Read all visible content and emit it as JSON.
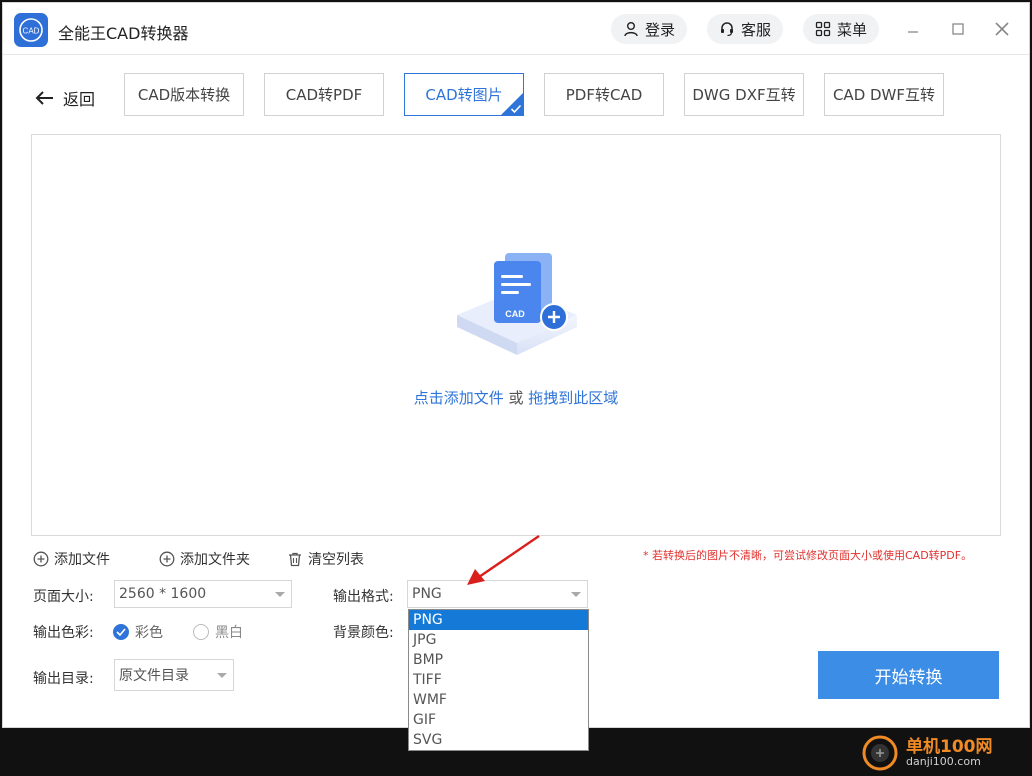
{
  "app": {
    "title": "全能王CAD转换器",
    "logo_text": "CAD"
  },
  "header": {
    "login_label": "登录",
    "service_label": "客服",
    "menu_label": "菜单"
  },
  "nav": {
    "back_label": "返回",
    "tabs": [
      {
        "label": "CAD版本转换",
        "active": false
      },
      {
        "label": "CAD转PDF",
        "active": false
      },
      {
        "label": "CAD转图片",
        "active": true
      },
      {
        "label": "PDF转CAD",
        "active": false
      },
      {
        "label": "DWG DXF互转",
        "active": false
      },
      {
        "label": "CAD DWF互转",
        "active": false
      }
    ]
  },
  "dropzone": {
    "illustration_text": "CAD",
    "click_text": "点击添加文件",
    "or_text": " 或 ",
    "drag_text": "拖拽到此区域"
  },
  "actions": {
    "add_file": "添加文件",
    "add_folder": "添加文件夹",
    "clear_list": "清空列表",
    "tip": "* 若转换后的图片不清晰，可尝试修改页面大小或使用CAD转PDF。"
  },
  "form": {
    "page_size_label": "页面大小:",
    "page_size_value": "2560 * 1600",
    "output_format_label": "输出格式:",
    "output_format_value": "PNG",
    "output_color_label": "输出色彩:",
    "color_option": "彩色",
    "bw_option": "黑白",
    "bg_color_label": "背景颜色:",
    "output_dir_label": "输出目录:",
    "output_dir_value": "原文件目录"
  },
  "format_dropdown": {
    "options": [
      "PNG",
      "JPG",
      "BMP",
      "TIFF",
      "WMF",
      "GIF",
      "SVG"
    ],
    "selected": "PNG"
  },
  "start_button": "开始转换",
  "watermark": {
    "title": "单机100网",
    "url": "danji100.com"
  },
  "colors": {
    "accent": "#2f74d8",
    "start_button": "#3c8de6",
    "tip": "#e0312d",
    "dropdown_selected": "#1479d7"
  }
}
